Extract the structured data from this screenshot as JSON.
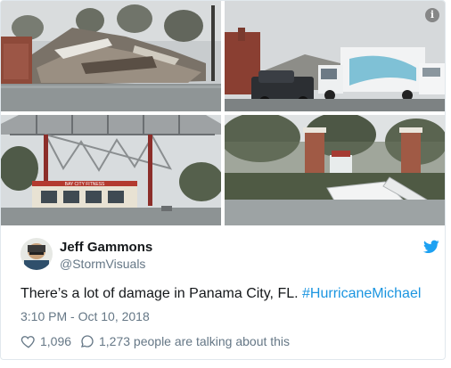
{
  "media": {
    "photos": [
      {
        "name": "destroyed-building"
      },
      {
        "name": "crashed-truck"
      },
      {
        "name": "collapsed-gas-station"
      },
      {
        "name": "damaged-gate"
      }
    ],
    "gas_station_sign": "BAY CITY FITNESS"
  },
  "author": {
    "name": "Jeff Gammons",
    "handle": "@StormVisuals"
  },
  "tweet": {
    "text": "There’s a lot of damage in Panama City, FL.",
    "hashtag": "#HurricaneMichael",
    "timestamp": "3:10 PM - Oct 10, 2018"
  },
  "actions": {
    "like_count": "1,096",
    "reply_text": "1,273 people are talking about this"
  },
  "colors": {
    "link": "#1b95e0",
    "muted": "#657786",
    "twitter": "#1da1f2",
    "border": "#e1e8ed"
  },
  "icons": {
    "info": "i"
  }
}
